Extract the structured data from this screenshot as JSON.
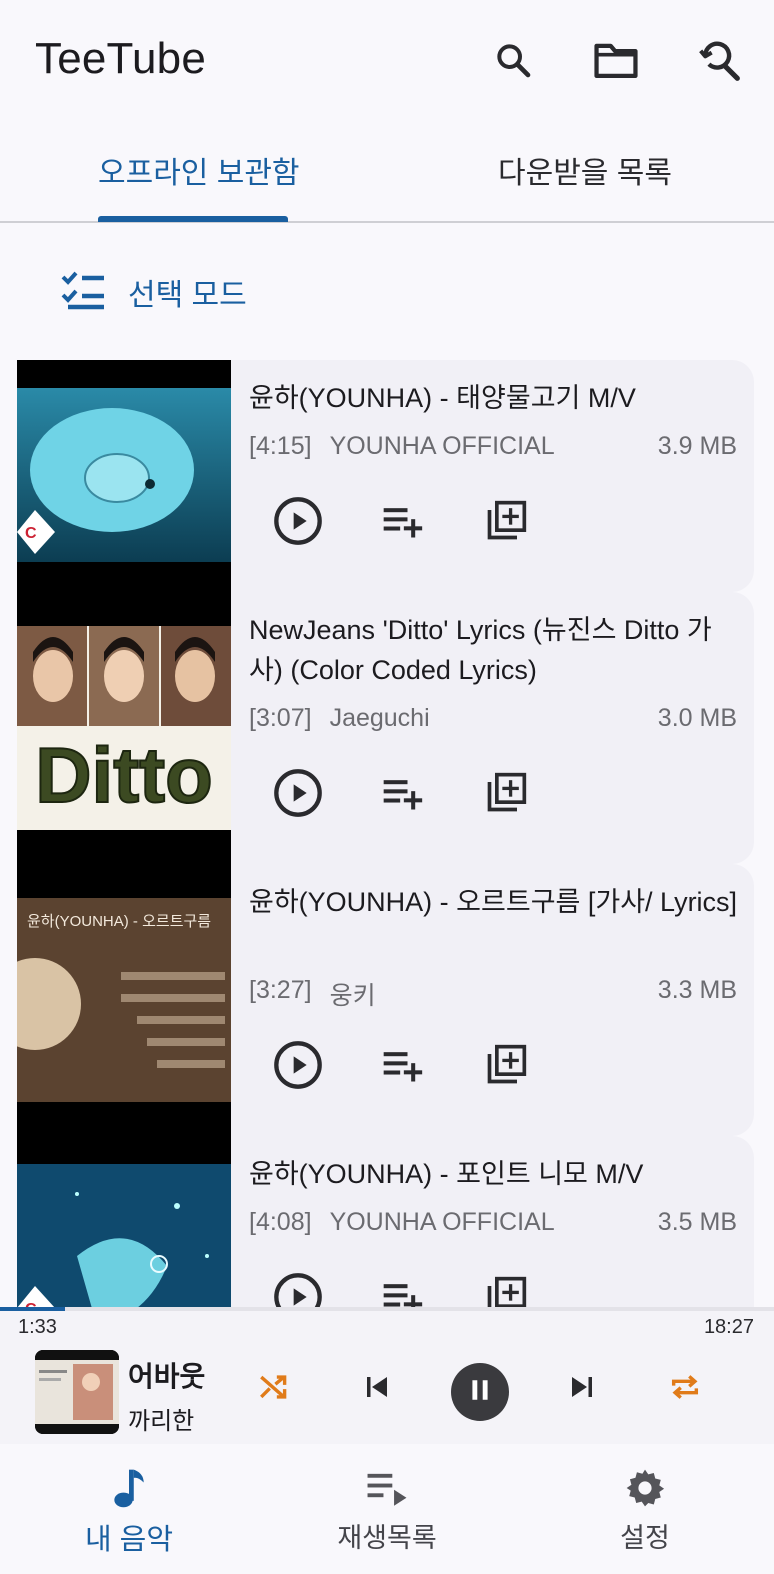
{
  "app": {
    "title": "TeeTube"
  },
  "appbar_icons": [
    "search-icon",
    "folder-icon",
    "search-history-icon"
  ],
  "tabs": [
    {
      "label": "오프라인 보관함",
      "active": true
    },
    {
      "label": "다운받을 목록",
      "active": false
    }
  ],
  "select_mode": {
    "label": "선택 모드",
    "icon": "checklist-icon"
  },
  "videos": [
    {
      "title": "윤하(YOUNHA) - 태양물고기 M/V",
      "duration": "[4:15]",
      "channel": "YOUNHA OFFICIAL",
      "size": "3.9 MB"
    },
    {
      "title": "NewJeans 'Ditto' Lyrics (뉴진스 Ditto 가사) (Color Coded Lyrics)",
      "duration": "[3:07]",
      "channel": "Jaeguchi",
      "size": "3.0 MB"
    },
    {
      "title": "윤하(YOUNHA) - 오르트구름 [가사/ Lyrics]",
      "duration": "[3:27]",
      "channel": "웅키",
      "size": "3.3 MB"
    },
    {
      "title": "윤하(YOUNHA) - 포인트 니모 M/V",
      "duration": "[4:08]",
      "channel": "YOUNHA OFFICIAL",
      "size": "3.5 MB"
    }
  ],
  "thumb_texts": {
    "ditto": "Ditto",
    "ort": "윤하(YOUNHA) - 오르트구름"
  },
  "player": {
    "current_time": "1:33",
    "total_time": "18:27",
    "progress": 0.084,
    "title": "어바웃",
    "artist": "까리한",
    "accent_color": "#e07b1a"
  },
  "nav": [
    {
      "label": "내 음악",
      "icon": "music-note-icon",
      "active": true
    },
    {
      "label": "재생목록",
      "icon": "playlist-play-icon",
      "active": false
    },
    {
      "label": "설정",
      "icon": "gear-icon",
      "active": false
    }
  ]
}
